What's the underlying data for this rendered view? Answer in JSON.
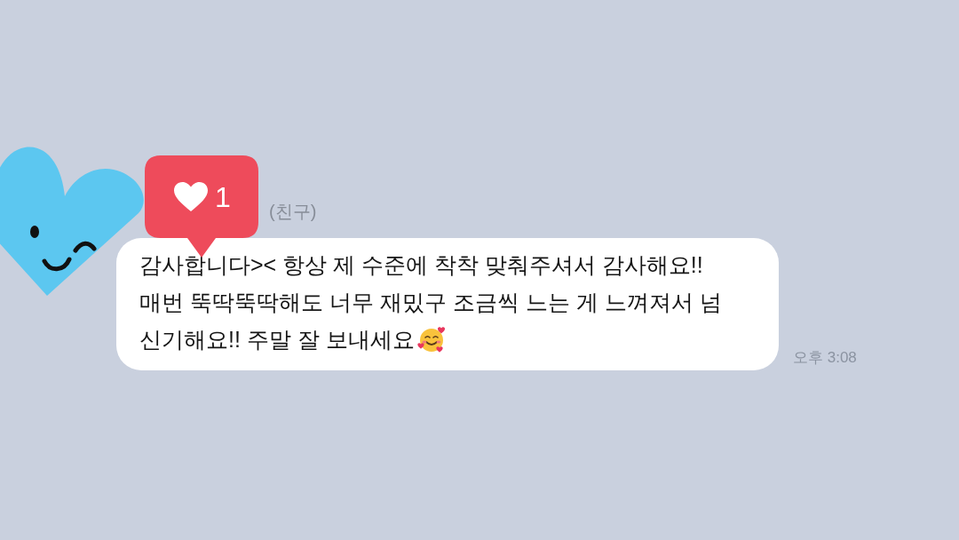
{
  "reaction": {
    "count": "1"
  },
  "message": {
    "sender_label": "(친구)",
    "lines": [
      "감사합니다>< 항상 제 수준에 착착 맞춰주셔서 감사해요!!",
      "매번 뚝딱뚝딱해도 너무 재밌구 조금씩 느는 게 느껴져서 넘",
      "신기해요!! 주말 잘 보내세요"
    ],
    "time": "오후 3:08"
  }
}
